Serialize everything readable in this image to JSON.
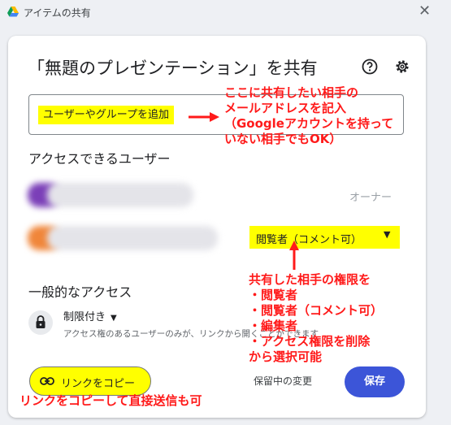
{
  "window": {
    "title": "アイテムの共有",
    "close_glyph": "✕"
  },
  "dialog": {
    "title": "「無題のプレゼンテーション」を共有",
    "help_icon": "help-circle-icon",
    "settings_icon": "gear-icon"
  },
  "add_people": {
    "placeholder": "ユーザーやグループを追加"
  },
  "people_access": {
    "heading": "アクセスできるユーザー",
    "users": [
      {
        "role": "オーナー"
      },
      {
        "role": "閲覧者（コメント可）"
      }
    ]
  },
  "general_access": {
    "heading": "一般的なアクセス",
    "restriction": "制限付き",
    "description": "アクセス権のあるユーザーのみが、リンクから開くことができます"
  },
  "footer": {
    "copy_link": "リンクをコピー",
    "pending": "保留中の変更",
    "save": "保存"
  },
  "annotations": {
    "add_note": [
      "ここに共有したい相手の",
      "メールアドレスを記入",
      "（Googleアカウントを持って",
      "いない相手でもOK）"
    ],
    "role_note": [
      "共有した相手の権限を",
      "・閲覧者",
      "・閲覧者（コメント可）",
      "・編集者",
      "・アクセス権限を削除",
      "から選択可能"
    ],
    "link_note": "リンクをコピーして直接送信も可"
  },
  "colors": {
    "highlight": "#ffff00",
    "annotation": "#ff1a1a",
    "save": "#3c55d8"
  }
}
